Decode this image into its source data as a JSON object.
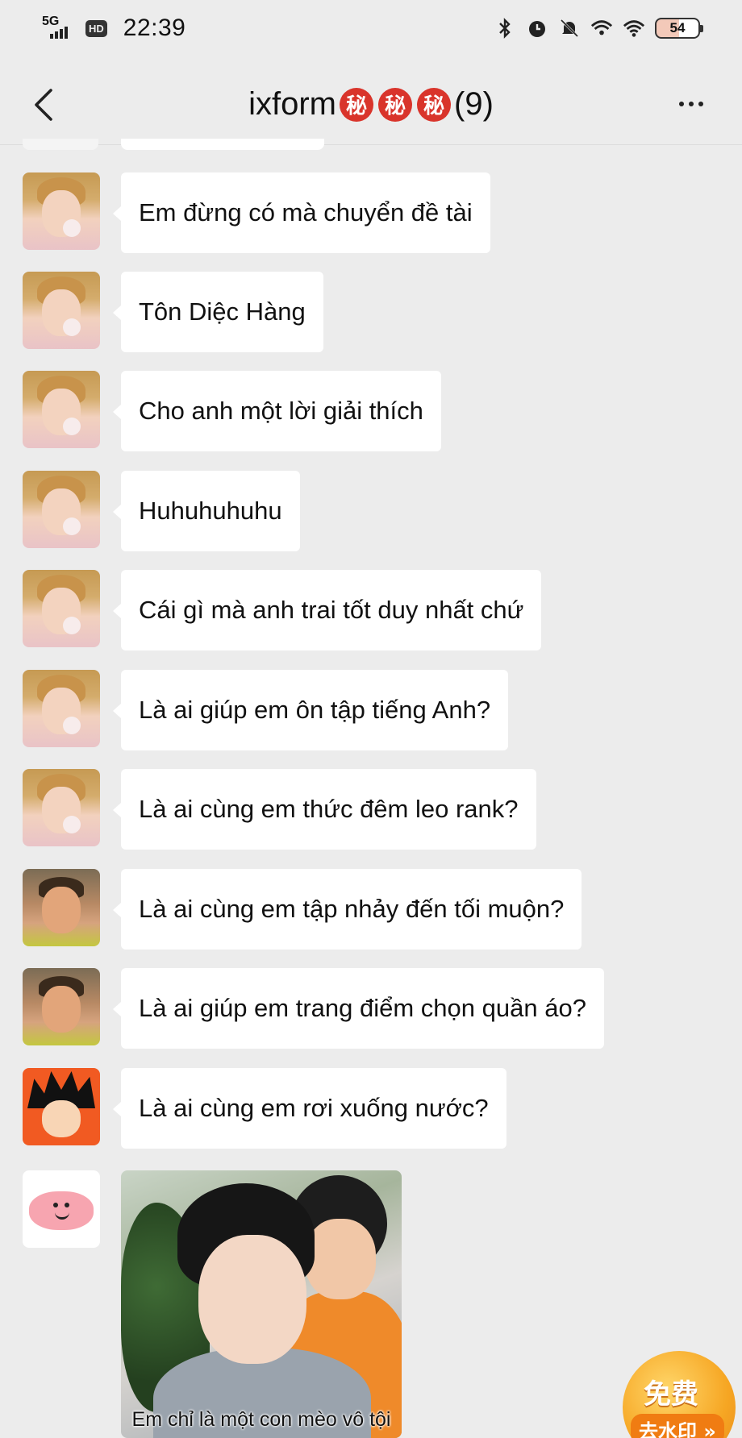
{
  "status_bar": {
    "network": "5G",
    "hd": "HD",
    "time": "22:39",
    "battery": "54",
    "icons": [
      "bluetooth-icon",
      "alarm-icon",
      "mute-icon",
      "wifi-plus-icon",
      "wifi-icon",
      "battery-icon"
    ]
  },
  "header": {
    "title": "ixform",
    "badges": [
      "秘",
      "秘",
      "秘"
    ],
    "count": "(9)"
  },
  "messages": [
    {
      "avatar": "boy-gum",
      "text": "Em đừng có mà chuyển đề tài"
    },
    {
      "avatar": "boy-gum",
      "text": "Tôn Diệc Hàng"
    },
    {
      "avatar": "boy-gum",
      "text": "Cho anh một lời giải thích"
    },
    {
      "avatar": "boy-gum",
      "text": "Huhuhuhuhu"
    },
    {
      "avatar": "boy-gum",
      "text": "Cái gì mà anh trai tốt duy nhất chứ"
    },
    {
      "avatar": "boy-gum",
      "text": "Là ai giúp em ôn tập tiếng Anh?"
    },
    {
      "avatar": "boy-gum",
      "text": "Là ai cùng em thức đêm leo rank?"
    },
    {
      "avatar": "kid",
      "text": "Là ai cùng em tập nhảy đến tối muộn?"
    },
    {
      "avatar": "kid",
      "text": "Là ai giúp em trang điểm chọn quần áo?"
    },
    {
      "avatar": "goku",
      "text": "Là ai cùng em rơi xuống nước?"
    }
  ],
  "image_message": {
    "avatar": "pig",
    "caption": "Em chỉ là một con mèo vô tội"
  },
  "promo": {
    "line1": "免费",
    "line2": "去水印 »"
  }
}
